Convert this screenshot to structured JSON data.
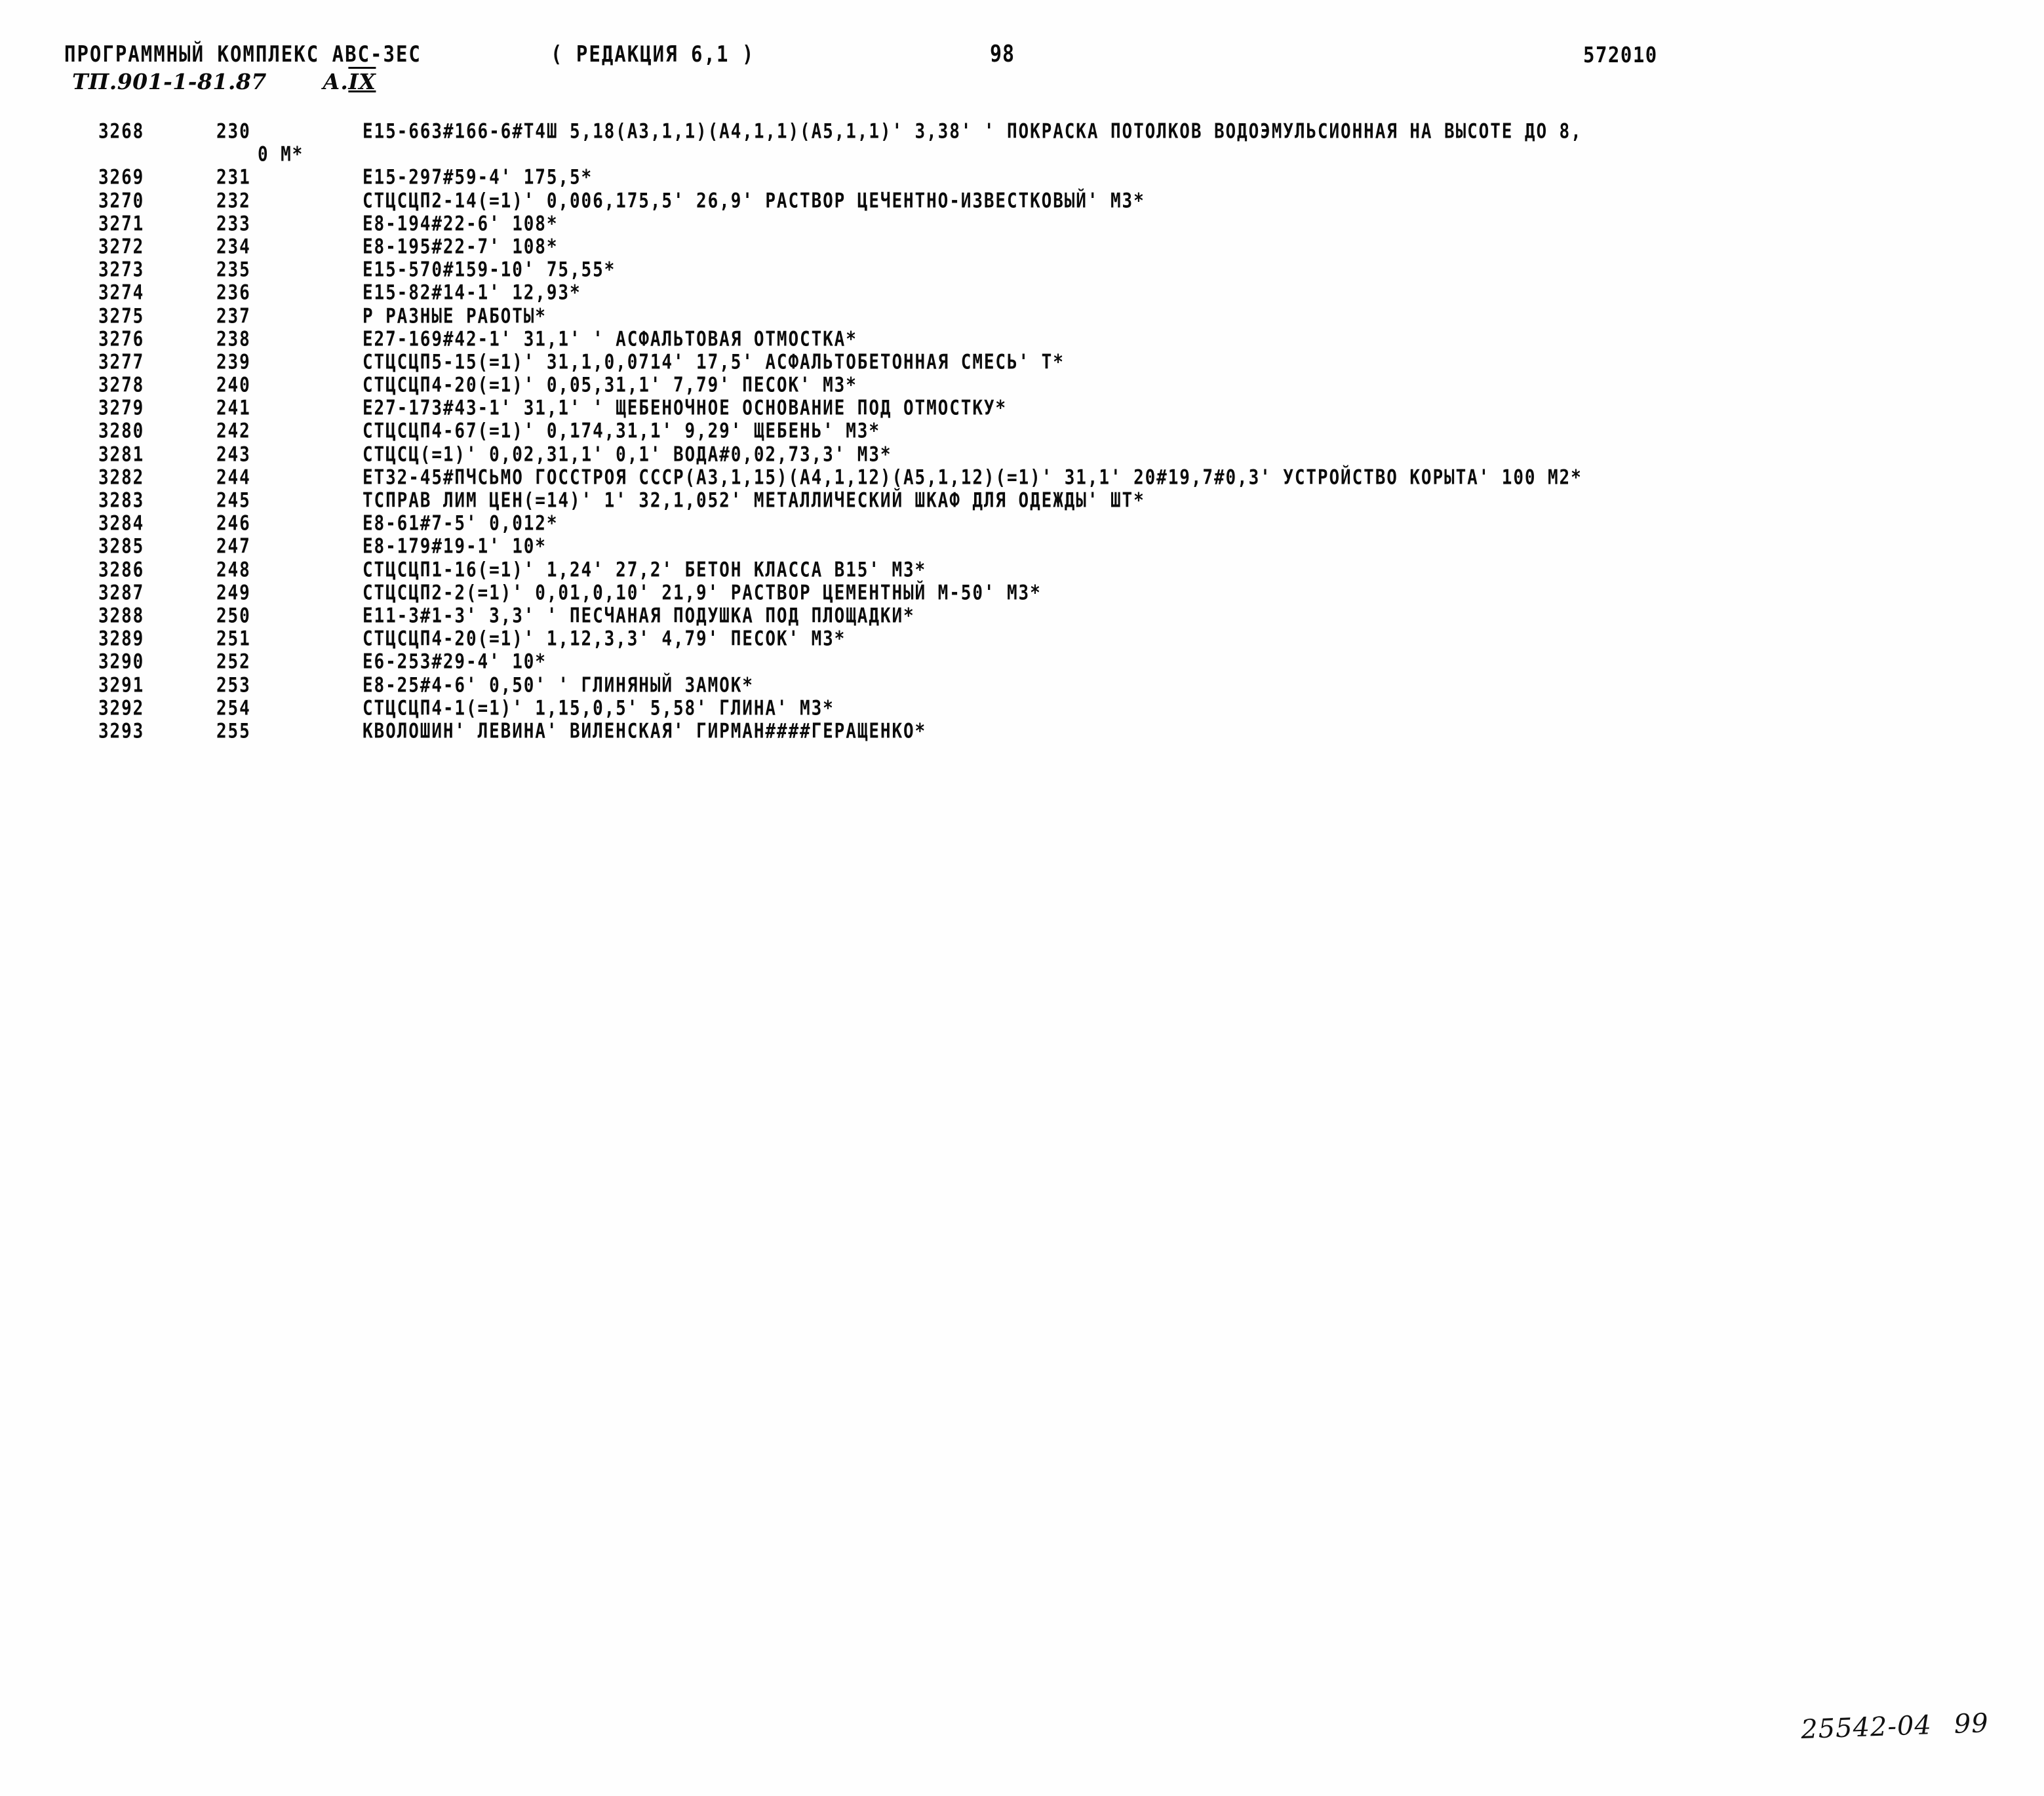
{
  "header": {
    "program_title": "ПРОГРАММНЫЙ КОМПЛЕКС АВС-3ЕС",
    "edition": "( РЕДАКЦИЯ 6,1 )",
    "page_number": "98",
    "doc_code": "572010",
    "project_code": "ТП.901-1-81.87",
    "album_prefix": "А.",
    "album_roman": "IX"
  },
  "listing": {
    "rows": [
      {
        "seq": "3268",
        "num": "230",
        "text": "Е15-663#166-6#Т4Ш 5,18(А3,1,1)(А4,1,1)(А5,1,1)' 3,38' ' ПОКРАСКА ПОТОЛКОВ ВОДОЭМУЛЬСИОННАЯ НА ВЫСОТЕ ДО 8,",
        "cont": "0 М*"
      },
      {
        "seq": "3269",
        "num": "231",
        "text": "Е15-297#59-4' 175,5*"
      },
      {
        "seq": "3270",
        "num": "232",
        "text": "СТЦСЦП2-14(=1)' 0,006,175,5' 26,9' РАСТВОР ЦЕЧЕНТНО-ИЗВЕСТКОВЫЙ' М3*"
      },
      {
        "seq": "3271",
        "num": "233",
        "text": "Е8-194#22-6' 108*"
      },
      {
        "seq": "3272",
        "num": "234",
        "text": "Е8-195#22-7' 108*"
      },
      {
        "seq": "3273",
        "num": "235",
        "text": "Е15-570#159-10' 75,55*"
      },
      {
        "seq": "3274",
        "num": "236",
        "text": "Е15-82#14-1' 12,93*"
      },
      {
        "seq": "3275",
        "num": "237",
        "text": "Р РАЗНЫЕ РАБОТЫ*"
      },
      {
        "seq": "3276",
        "num": "238",
        "text": "Е27-169#42-1' 31,1' ' АСФАЛЬТОВАЯ ОТМОСТКА*"
      },
      {
        "seq": "3277",
        "num": "239",
        "text": "СТЦСЦП5-15(=1)' 31,1,0,0714' 17,5' АСФАЛЬТОБЕТОННАЯ СМЕСЬ' Т*"
      },
      {
        "seq": "3278",
        "num": "240",
        "text": "СТЦСЦП4-20(=1)' 0,05,31,1' 7,79' ПЕСОК' М3*"
      },
      {
        "seq": "3279",
        "num": "241",
        "text": "Е27-173#43-1' 31,1' ' ЩЕБЕНОЧНОЕ ОСНОВАНИЕ ПОД ОТМОСТКУ*"
      },
      {
        "seq": "3280",
        "num": "242",
        "text": "СТЦСЦП4-67(=1)' 0,174,31,1' 9,29' ЩЕБЕНЬ' М3*"
      },
      {
        "seq": "3281",
        "num": "243",
        "text": "СТЦСЦ(=1)' 0,02,31,1' 0,1' ВОДА#0,02,73,3' М3*"
      },
      {
        "seq": "3282",
        "num": "244",
        "text": "ЕТ32-45#ПЧСЬМО ГОССТРОЯ СССР(А3,1,15)(А4,1,12)(А5,1,12)(=1)' 31,1' 20#19,7#0,3' УСТРОЙСТВО КОРЫТА' 100 М2*"
      },
      {
        "seq": "3283",
        "num": "245",
        "text": "ТСПРАВ ЛИМ ЦЕН(=14)' 1' 32,1,052' МЕТАЛЛИЧЕСКИЙ ШКАФ ДЛЯ ОДЕЖДЫ' ШТ*"
      },
      {
        "seq": "3284",
        "num": "246",
        "text": "Е8-61#7-5' 0,012*"
      },
      {
        "seq": "3285",
        "num": "247",
        "text": "Е8-179#19-1' 10*"
      },
      {
        "seq": "3286",
        "num": "248",
        "text": "СТЦСЦП1-16(=1)' 1,24' 27,2' БЕТОН КЛАССА В15' М3*"
      },
      {
        "seq": "3287",
        "num": "249",
        "text": "СТЦСЦП2-2(=1)' 0,01,0,10' 21,9' РАСТВОР ЦЕМЕНТНЫЙ М-50' М3*"
      },
      {
        "seq": "3288",
        "num": "250",
        "text": "Е11-3#1-3' 3,3' ' ПЕСЧАНАЯ ПОДУШКА ПОД ПЛОЩАДКИ*"
      },
      {
        "seq": "3289",
        "num": "251",
        "text": "СТЦСЦП4-20(=1)' 1,12,3,3' 4,79' ПЕСОК' М3*"
      },
      {
        "seq": "3290",
        "num": "252",
        "text": "Е6-253#29-4' 10*"
      },
      {
        "seq": "3291",
        "num": "253",
        "text": "Е8-25#4-6' 0,50' ' ГЛИНЯНЫЙ ЗАМОК*"
      },
      {
        "seq": "3292",
        "num": "254",
        "text": "СТЦСЦП4-1(=1)' 1,15,0,5' 5,58' ГЛИНА' М3*"
      },
      {
        "seq": "3293",
        "num": "255",
        "text": "КВОЛОШИН' ЛЕВИНА' ВИЛЕНСКАЯ' ГИРМАН####ГЕРАЩЕНКО*"
      }
    ]
  },
  "footer": {
    "archive_mark": "25542-04",
    "sheet_number": "99"
  }
}
